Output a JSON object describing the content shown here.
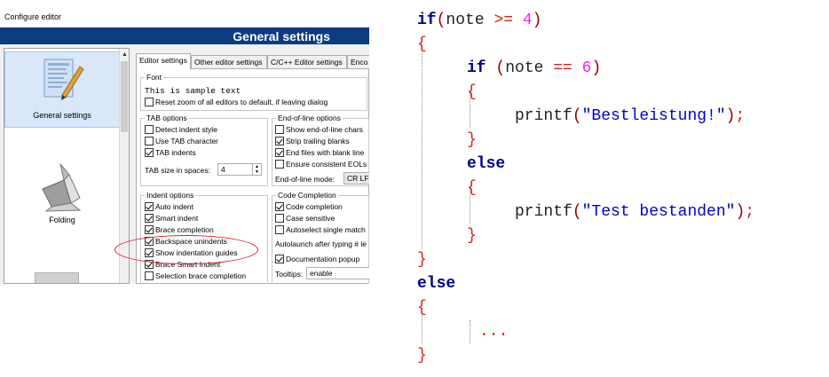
{
  "dialog": {
    "title": "Configure editor",
    "banner": "General settings",
    "sidebar": [
      {
        "label": "General settings",
        "icon": "general-settings-icon"
      },
      {
        "label": "Folding",
        "icon": "folding-origami-icon"
      }
    ],
    "tabs": [
      "Editor settings",
      "Other editor settings",
      "C/C++ Editor settings",
      "Enco"
    ],
    "font": {
      "group": "Font",
      "sample": "This is sample text",
      "reset_zoom": "Reset zoom of all editors to default, if leaving dialog"
    },
    "tab_options": {
      "group": "TAB options",
      "detect_indent": "Detect indent style",
      "use_tab": "Use TAB character",
      "tab_indents": "TAB indents",
      "tab_size_label": "TAB size in spaces:",
      "tab_size_value": "4"
    },
    "eol_options": {
      "group": "End-of-line options",
      "show_eol": "Show end-of-line chars",
      "strip_trailing": "Strip trailing blanks",
      "end_files_blank": "End files with blank line",
      "ensure_eols": "Ensure consistent EOLs",
      "mode_label": "End-of-line mode:",
      "mode_value": "CR LF"
    },
    "indent_options": {
      "group": "Indent options",
      "auto_indent": "Auto indent",
      "smart_indent": "Smart indent",
      "brace_completion": "Brace completion",
      "backspace_unindents": "Backspace unindents",
      "show_guides": "Show indentation guides",
      "brace_smart": "Brace Smart Indent",
      "selection_brace": "Selection brace completion"
    },
    "code_completion": {
      "group": "Code Completion",
      "code_completion": "Code completion",
      "case_sensitive": "Case sensitive",
      "autoselect": "Autoselect single match",
      "autolaunch": "Autolaunch after typing # le",
      "doc_popup": "Documentation popup",
      "tooltips_label": "Tooltips:",
      "tooltips_value": "enable"
    }
  },
  "code": {
    "kw_if": "if",
    "kw_else": "else",
    "cond1_paren_open": "(",
    "cond1_var": "note ",
    "cond1_op": ">=",
    "cond1_num": " 4",
    "cond1_paren_close": ")",
    "brace_open": "{",
    "brace_close": "}",
    "cond2_paren_open": " (",
    "cond2_var": "note ",
    "cond2_op": "==",
    "cond2_num": " 6",
    "cond2_paren_close": ")",
    "printf": "printf",
    "call_open": "(",
    "call_close": ")",
    "semicolon": ";",
    "str1": "\"Bestleistung!\"",
    "str2": "\"Test bestanden\"",
    "ellipsis": "..."
  }
}
